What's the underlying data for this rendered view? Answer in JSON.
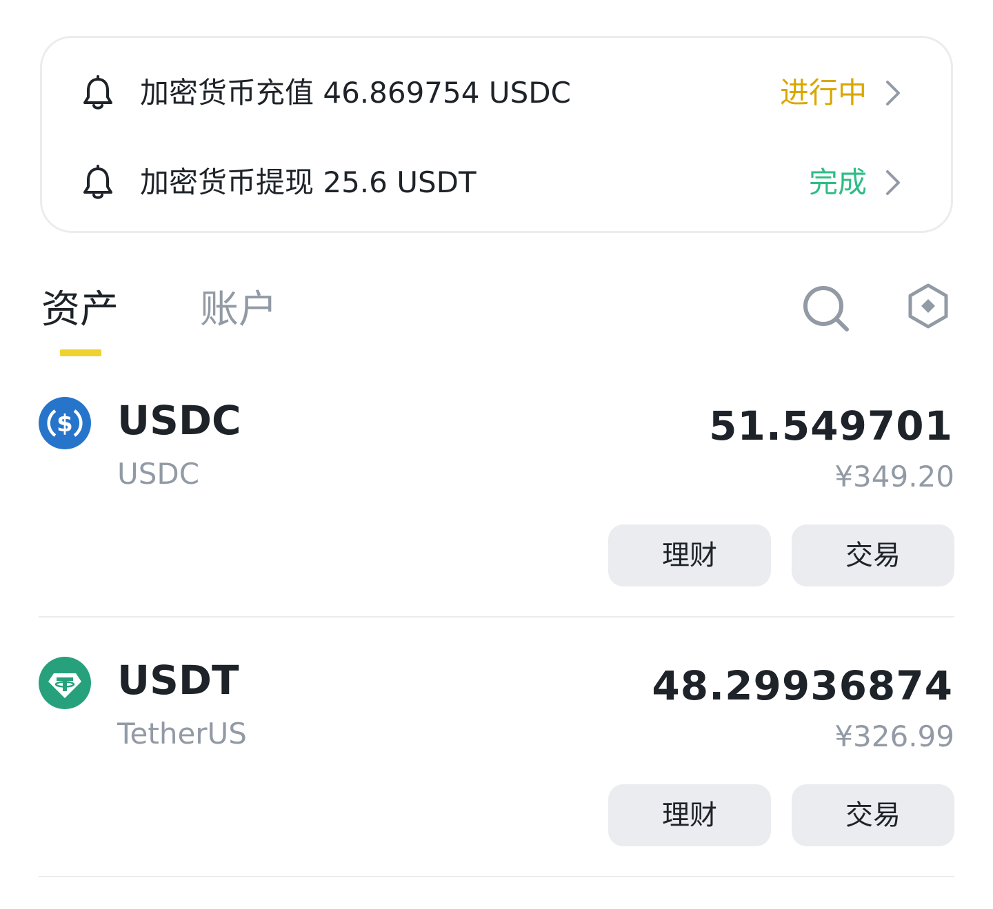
{
  "notifications": [
    {
      "text": "加密货币充值 46.869754 USDC",
      "status": "进行中",
      "status_color": "#d8a800",
      "icon": "bell-icon"
    },
    {
      "text": "加密货币提现 25.6 USDT",
      "status": "完成",
      "status_color": "#2ebd85",
      "icon": "bell-icon"
    }
  ],
  "tabs": {
    "assets": "资产",
    "account": "账户",
    "active": "assets",
    "underline_color": "#f0d22f"
  },
  "toolbar": {
    "search_icon": "search-icon",
    "settings_icon": "hexagon-settings-icon"
  },
  "assets": [
    {
      "symbol": "USDC",
      "name": "USDC",
      "amount": "51.549701",
      "fiat": "¥349.20",
      "icon": "usdc-coin-icon",
      "icon_color": "#2775ca",
      "earn_label": "理财",
      "trade_label": "交易"
    },
    {
      "symbol": "USDT",
      "name": "TetherUS",
      "amount": "48.29936874",
      "fiat": "¥326.99",
      "icon": "usdt-coin-icon",
      "icon_color": "#26a17b",
      "earn_label": "理财",
      "trade_label": "交易"
    }
  ]
}
